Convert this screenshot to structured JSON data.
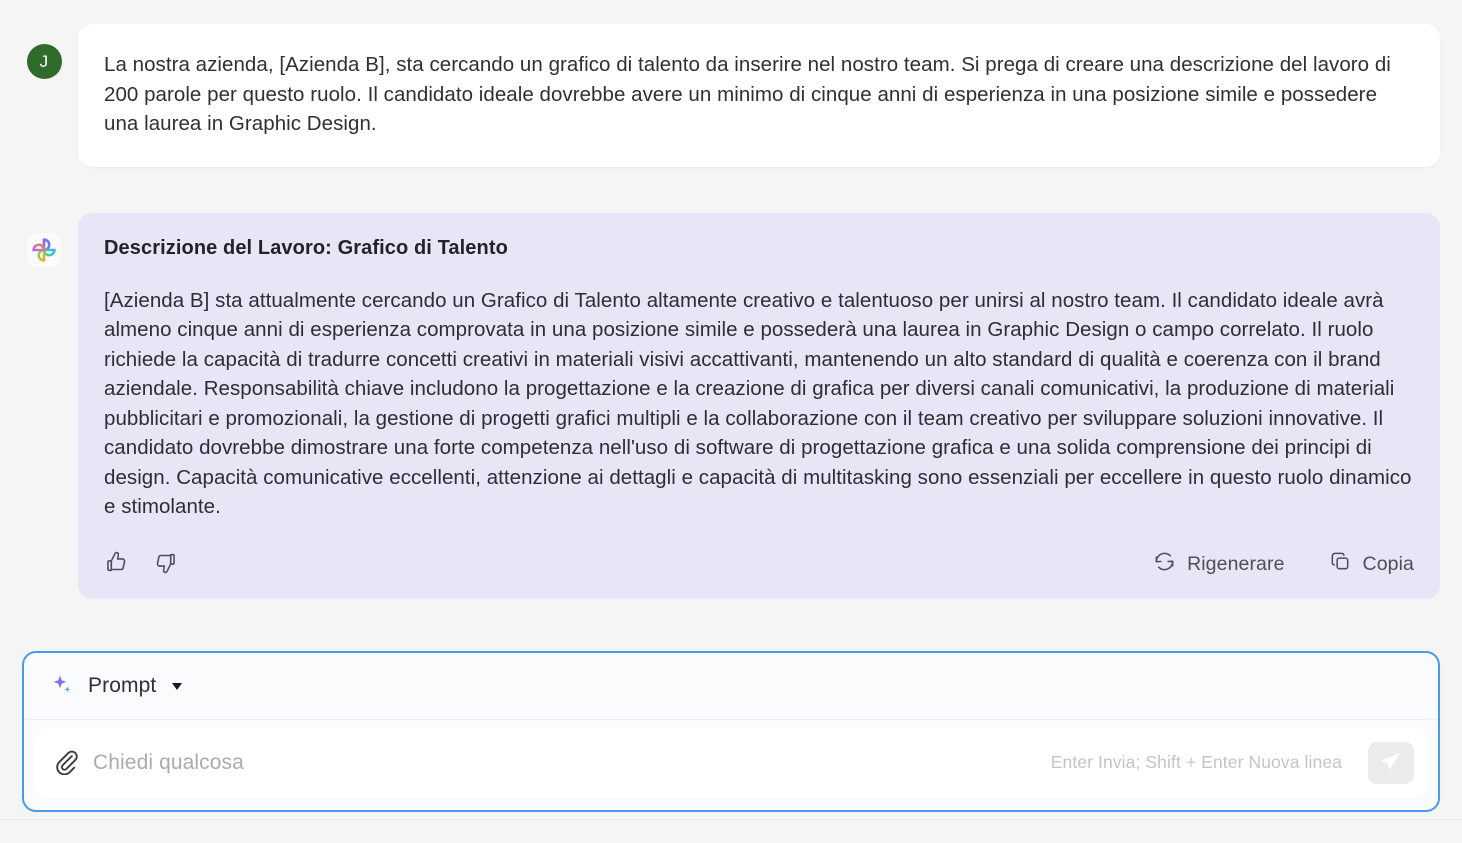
{
  "colors": {
    "page_background": "#f5f5f6",
    "user_bubble": "#ffffff",
    "assistant_bubble": "#e8e6f6",
    "user_avatar": "#2f6b2a",
    "composer_border_focus": "#4a9bea",
    "send_button_background": "#ececee",
    "text_primary": "#2f3033",
    "hint_text": "#c3c4c8"
  },
  "conversation": {
    "user_message": {
      "avatar_initial": "J",
      "avatar_name": "user-avatar",
      "text": "La nostra azienda, [Azienda B], sta cercando un grafico di talento da inserire nel nostro team. Si prega di creare una descrizione del lavoro di 200 parole per questo ruolo. Il candidato ideale dovrebbe avere un minimo di cinque anni di esperienza in una posizione simile e possedere una laurea in Graphic Design."
    },
    "assistant_message": {
      "avatar_icon": "ai-clover-icon",
      "title": "Descrizione del Lavoro: Grafico di Talento",
      "text": "[Azienda B] sta attualmente cercando un Grafico di Talento altamente creativo e talentuoso per unirsi al nostro team. Il candidato ideale avrà almeno cinque anni di esperienza comprovata in una posizione simile e possederà una laurea in Graphic Design o campo correlato. Il ruolo richiede la capacità di tradurre concetti creativi in materiali visivi accattivanti, mantenendo un alto standard di qualità e coerenza con il brand aziendale. Responsabilità chiave includono la progettazione e la creazione di grafica per diversi canali comunicativi, la produzione di materiali pubblicitari e promozionali, la gestione di progetti grafici multipli e la collaborazione con il team creativo per sviluppare soluzioni innovative. Il candidato dovrebbe dimostrare una forte competenza nell'uso di software di progettazione grafica e una solida comprensione dei principi di design. Capacità comunicative eccellenti, attenzione ai dettagli e capacità di multitasking sono essenziali per eccellere in questo ruolo dinamico e stimolante.",
      "actions": {
        "thumbs_up_icon": "thumbs-up-icon",
        "thumbs_down_icon": "thumbs-down-icon",
        "regenerate_label": "Rigenerare",
        "regenerate_icon": "refresh-icon",
        "copy_label": "Copia",
        "copy_icon": "copy-icon"
      }
    }
  },
  "composer": {
    "mode_label": "Prompt",
    "mode_icon": "sparkle-icon",
    "dropdown_icon": "chevron-down-icon",
    "attach_icon": "paperclip-icon",
    "input_value": "",
    "input_placeholder": "Chiedi qualcosa",
    "keyboard_hint": "Enter Invia; Shift + Enter Nuova linea",
    "send_icon": "send-icon"
  }
}
